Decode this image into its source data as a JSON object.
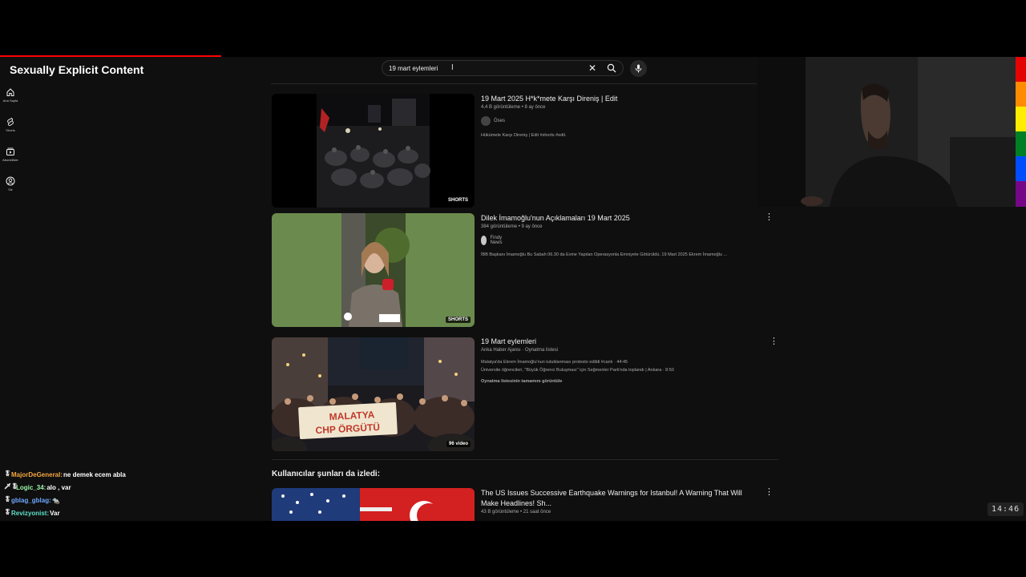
{
  "stream": {
    "title": "Sexually Explicit Content",
    "timer": "14:46"
  },
  "search": {
    "query": "19 mart eylemleri"
  },
  "sidebar": {
    "items": [
      {
        "label": "Ana Sayfa",
        "icon": "home-icon"
      },
      {
        "label": "Shorts",
        "icon": "shorts-icon"
      },
      {
        "label": "Abonelikler",
        "icon": "subscriptions-icon"
      },
      {
        "label": "Siz",
        "icon": "profile-icon"
      }
    ]
  },
  "results": [
    {
      "title": "19 Mart 2025 H*k*mete Karşı Direniş | Edit",
      "meta": "4,4 B görüntüleme • 8 ay önce",
      "channel": "Öses",
      "description": "Hükümete Karşı Direniş | Edit #shorts #edit.",
      "badge": "SHORTS"
    },
    {
      "title": "Dilek İmamoğlu'nun Açıklamaları 19 Mart 2025",
      "meta": "384 görüntüleme • 9 ay önce",
      "channel": "Findy News",
      "description": "İBB Başkanı İmamoğlu Bu Sabah 06.30 da Evine Yapılan Operasyonla Emniyete Götürüldü. 19 Mart 2025 Ekrem İmamoğlu ...",
      "badge": "SHORTS"
    },
    {
      "title": "19 Mart eylemleri",
      "meta": "Anka Haber Ajansı · Oynatma listesi",
      "line1": "Malatya'da Ekrem İmamoğlu'nun tutuklanması protesto edildi #canlı · 44:45",
      "line2": "Üniversite öğrencileri, \"Büyük Öğrenci Buluşması\" için Seğmenler Park'nda toplandı | Ankara · 8:50",
      "link": "Oynatma listesinin tamamını görüntüle",
      "badge": "96 video",
      "banner_text_1": "MALATYA",
      "banner_text_2": "CHP ÖRGÜTÜ"
    }
  ],
  "section": {
    "title": "Kullanıcılar şunları da izledi:"
  },
  "next_result": {
    "title_line1": "The US Issues Successive Earthquake Warnings for Istanbul! A Warning That Will",
    "title_line2": "Make Headlines! Sh...",
    "meta": "43 B görüntüleme • 21 saat önce"
  },
  "chat": [
    {
      "badges": "🎖",
      "user": "MajorDeGeneral:",
      "message": "ne demek ecem abla",
      "color": "#f4a742"
    },
    {
      "badges": "🗡🎖",
      "user": "Logic_34:",
      "message": "alo , var",
      "color": "#9cf5a8"
    },
    {
      "badges": "🎖",
      "user": "gblag_gblag:",
      "message": "🐀",
      "color": "#6ea8ff"
    },
    {
      "badges": "🎖",
      "user": "Revizyonist:",
      "message": "Var",
      "color": "#5ee0c8"
    }
  ],
  "colors": {
    "accent": "#ff0000",
    "background": "#0f0f0f"
  }
}
